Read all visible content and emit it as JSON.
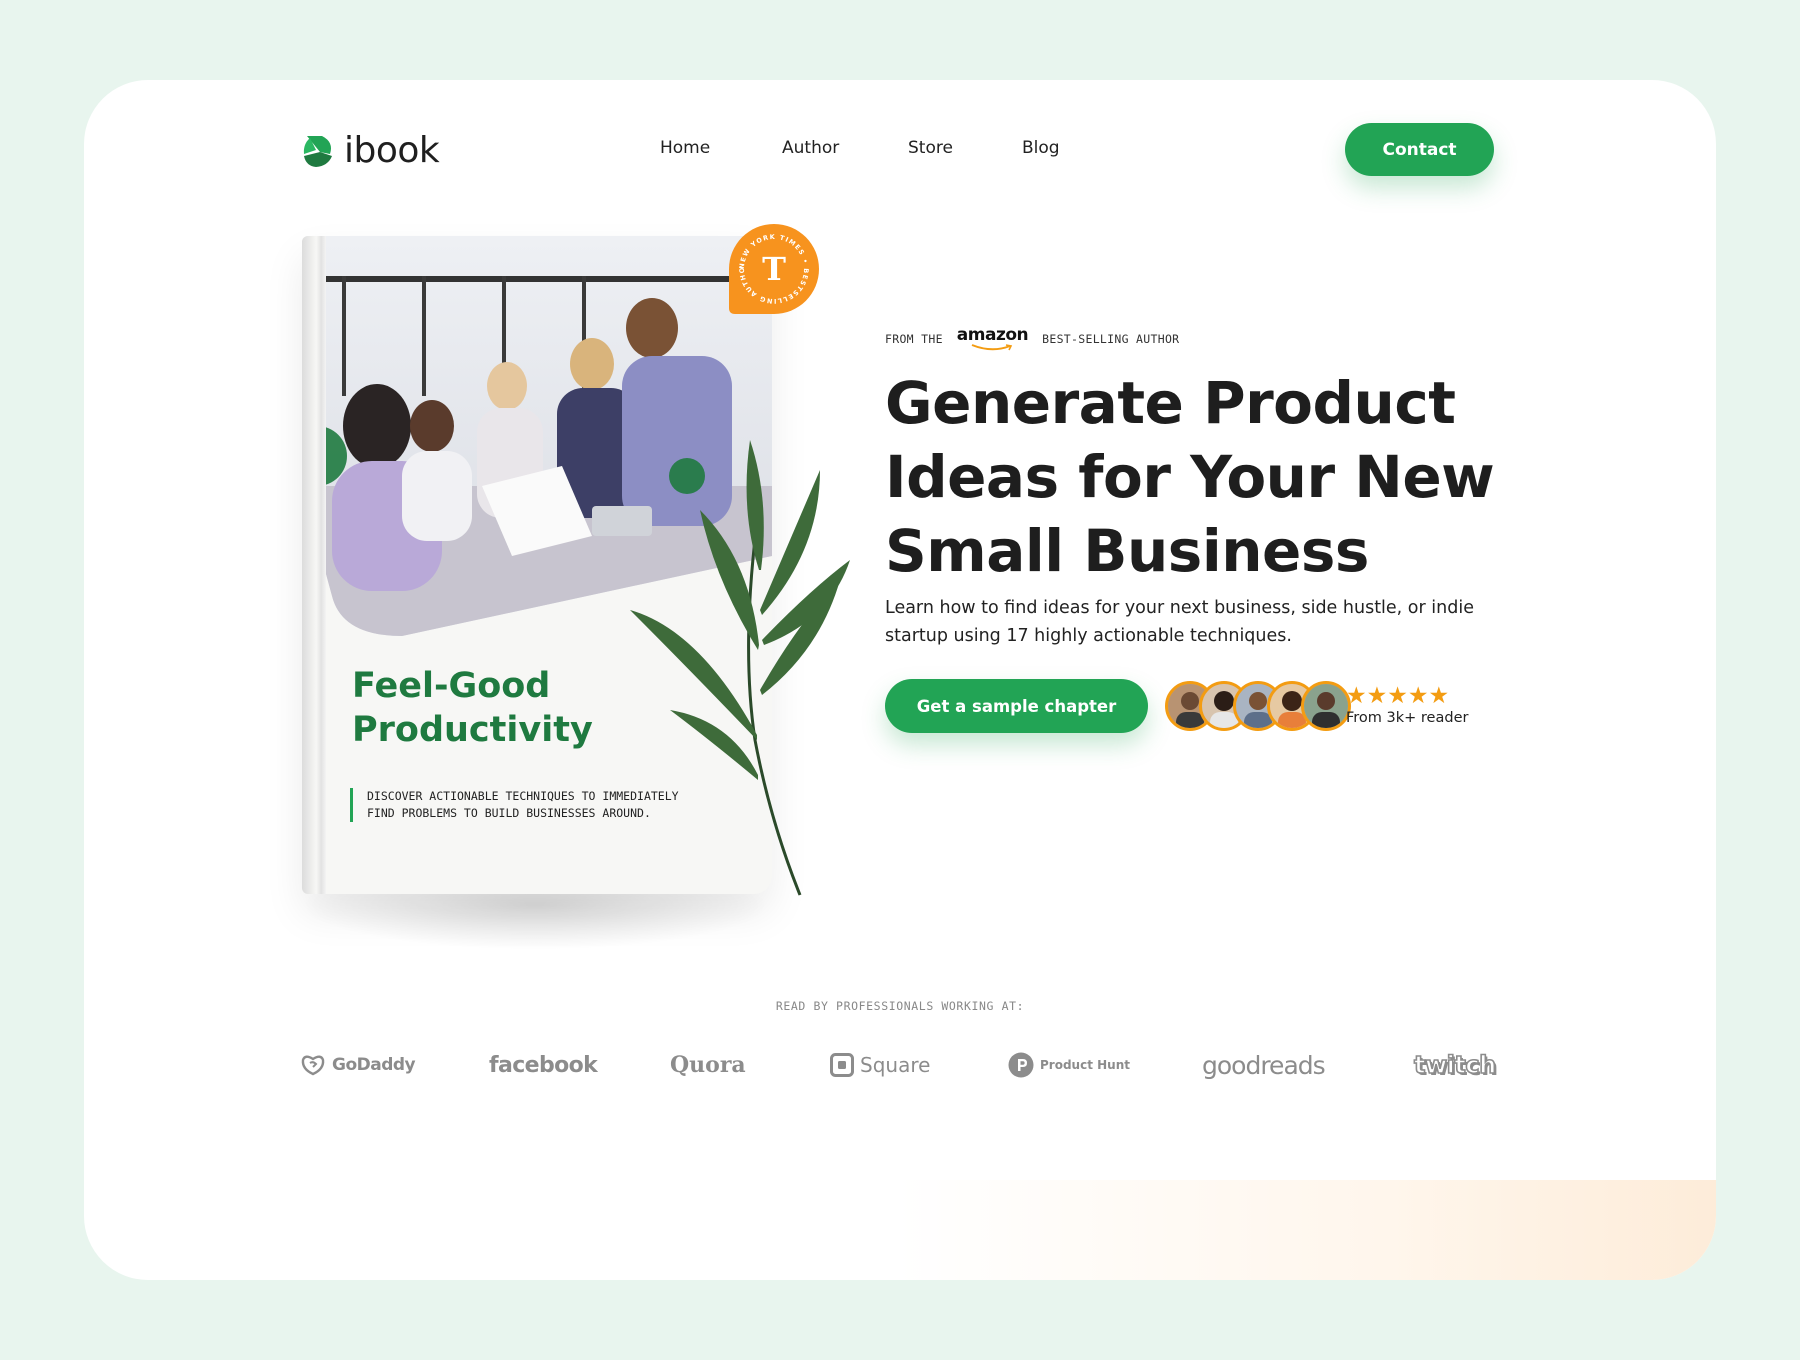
{
  "header": {
    "logo_text": "ibook",
    "nav": [
      "Home",
      "Author",
      "Store",
      "Blog"
    ],
    "contact_label": "Contact"
  },
  "book": {
    "badge_text": "NEW YORK TIMES • BESTSELLING AUTHOR •",
    "badge_letter": "T",
    "title_line1": "Feel-Good",
    "title_line2": "Productivity",
    "desc_line1": "DISCOVER ACTIONABLE TECHNIQUES TO IMMEDIATELY",
    "desc_line2": "FIND PROBLEMS TO BUILD BUSINESSES AROUND."
  },
  "hero": {
    "eyebrow_prefix": "FROM THE",
    "eyebrow_brand": "amazon",
    "eyebrow_suffix": "BEST-SELLING AUTHOR",
    "headline_line1": "Generate Product",
    "headline_line2": "Ideas for Your New",
    "headline_line3": "Small Business",
    "subtext_line1": "Learn how to find ideas for your next business, side hustle, or indie",
    "subtext_line2": "startup using 17 highly actionable techniques.",
    "cta_label": "Get a sample chapter",
    "stars": "★★★★★",
    "reader_text": "From 3k+ reader"
  },
  "brands": {
    "label": "READ BY PROFESSIONALS WORKING AT:",
    "items": [
      "GoDaddy",
      "facebook",
      "Quora",
      "Square",
      "Product Hunt",
      "goodreads",
      "twitch"
    ]
  },
  "colors": {
    "background": "#e8f5ee",
    "primary_green": "#22a455",
    "book_title_green": "#1f7a40",
    "badge_orange": "#f7931e",
    "star_orange": "#f39c12"
  },
  "icons": [
    "logo-mark-icon",
    "amazon-smile-icon",
    "nyt-t-icon",
    "star-icon",
    "square-logo-icon",
    "product-hunt-icon",
    "godaddy-icon"
  ]
}
